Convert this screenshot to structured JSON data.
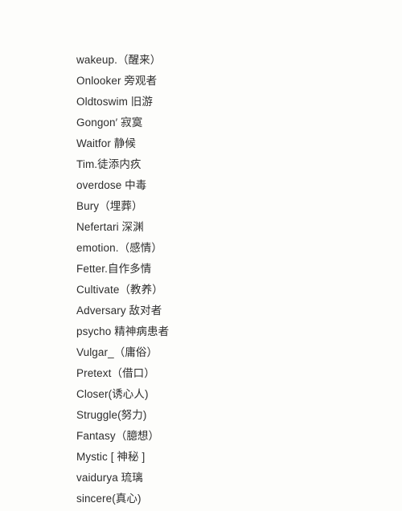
{
  "page": {
    "background_color": "#fdfdfb",
    "text_color": "#2d2d2d"
  },
  "word_list": {
    "items": [
      {
        "text": "wakeup.（醒来）"
      },
      {
        "text": "Onlooker 旁观者"
      },
      {
        "text": "Oldtoswim 旧游"
      },
      {
        "text": "Gongon′ 寂寞"
      },
      {
        "text": "Waitfor 静候"
      },
      {
        "text": "Tim.徒添内疚"
      },
      {
        "text": "overdose 中毒"
      },
      {
        "text": "Bury（埋葬）"
      },
      {
        "text": "Nefertari 深渊"
      },
      {
        "text": "emotion.（感情）"
      },
      {
        "text": "Fetter.自作多情"
      },
      {
        "text": "Cultivate（教养）"
      },
      {
        "text": "Adversary 敌对者"
      },
      {
        "text": "psycho 精神病患者"
      },
      {
        "text": "Vulgar_（庸俗）"
      },
      {
        "text": "Pretext（借口）"
      },
      {
        "text": "Closer(诱心人)"
      },
      {
        "text": "Struggle(努力)"
      },
      {
        "text": "Fantasy（臆想）"
      },
      {
        "text": "Mystic [ 神秘 ]"
      },
      {
        "text": "vaidurya 琉璃"
      },
      {
        "text": "sincere(真心)"
      }
    ]
  }
}
